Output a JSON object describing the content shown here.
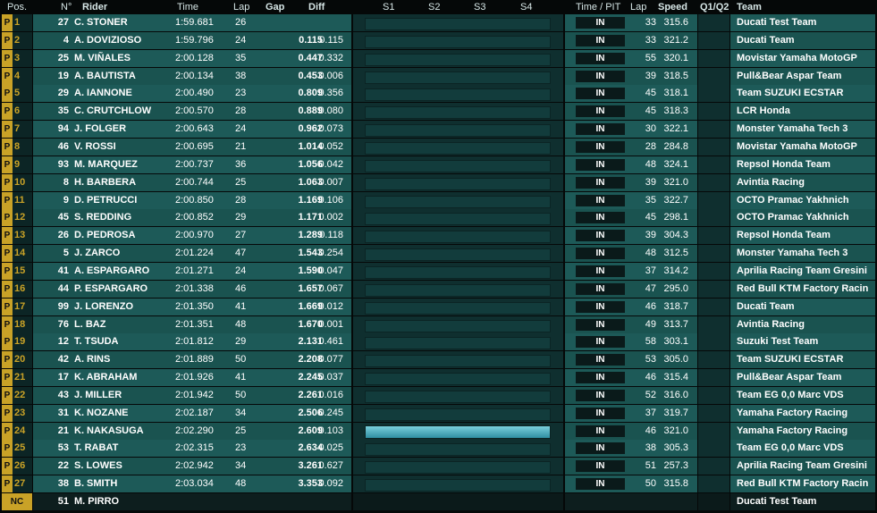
{
  "header": {
    "pos": "Pos.",
    "num": "N°",
    "rider": "Rider",
    "time": "Time",
    "lap": "Lap",
    "gap": "Gap",
    "diff": "Diff",
    "s1": "S1",
    "s2": "S2",
    "s3": "S3",
    "s4": "S4",
    "time_pit": "Time / PIT",
    "lap2": "Lap",
    "speed": "Speed",
    "q": "Q1/Q2",
    "team": "Team"
  },
  "rows": [
    {
      "flag": "P",
      "pos": "1",
      "num": "27",
      "rider": "C. STONER",
      "time": "1:59.681",
      "lap": "26",
      "gap": "",
      "diff": "",
      "pit": "IN",
      "plap": "33",
      "speed": "315.6",
      "team": "Ducati Test Team",
      "sector_active": false
    },
    {
      "flag": "P",
      "pos": "2",
      "num": "4",
      "rider": "A. DOVIZIOSO",
      "time": "1:59.796",
      "lap": "24",
      "gap": "0.115",
      "diff": "0.115",
      "pit": "IN",
      "plap": "33",
      "speed": "321.2",
      "team": "Ducati Team",
      "sector_active": false
    },
    {
      "flag": "P",
      "pos": "3",
      "num": "25",
      "rider": "M. VIÑALES",
      "time": "2:00.128",
      "lap": "35",
      "gap": "0.447",
      "diff": "0.332",
      "pit": "IN",
      "plap": "55",
      "speed": "320.1",
      "team": "Movistar Yamaha MotoGP",
      "sector_active": false
    },
    {
      "flag": "P",
      "pos": "4",
      "num": "19",
      "rider": "A. BAUTISTA",
      "time": "2:00.134",
      "lap": "38",
      "gap": "0.453",
      "diff": "0.006",
      "pit": "IN",
      "plap": "39",
      "speed": "318.5",
      "team": "Pull&Bear Aspar Team",
      "sector_active": false
    },
    {
      "flag": "P",
      "pos": "5",
      "num": "29",
      "rider": "A. IANNONE",
      "time": "2:00.490",
      "lap": "23",
      "gap": "0.809",
      "diff": "0.356",
      "pit": "IN",
      "plap": "45",
      "speed": "318.1",
      "team": "Team SUZUKI ECSTAR",
      "sector_active": false
    },
    {
      "flag": "P",
      "pos": "6",
      "num": "35",
      "rider": "C. CRUTCHLOW",
      "time": "2:00.570",
      "lap": "28",
      "gap": "0.889",
      "diff": "0.080",
      "pit": "IN",
      "plap": "45",
      "speed": "318.3",
      "team": "LCR Honda",
      "sector_active": false
    },
    {
      "flag": "P",
      "pos": "7",
      "num": "94",
      "rider": "J. FOLGER",
      "time": "2:00.643",
      "lap": "24",
      "gap": "0.962",
      "diff": "0.073",
      "pit": "IN",
      "plap": "30",
      "speed": "322.1",
      "team": "Monster Yamaha Tech 3",
      "sector_active": false
    },
    {
      "flag": "P",
      "pos": "8",
      "num": "46",
      "rider": "V. ROSSI",
      "time": "2:00.695",
      "lap": "21",
      "gap": "1.014",
      "diff": "0.052",
      "pit": "IN",
      "plap": "28",
      "speed": "284.8",
      "team": "Movistar Yamaha MotoGP",
      "sector_active": false
    },
    {
      "flag": "P",
      "pos": "9",
      "num": "93",
      "rider": "M. MARQUEZ",
      "time": "2:00.737",
      "lap": "36",
      "gap": "1.056",
      "diff": "0.042",
      "pit": "IN",
      "plap": "48",
      "speed": "324.1",
      "team": "Repsol Honda Team",
      "sector_active": false
    },
    {
      "flag": "P",
      "pos": "10",
      "num": "8",
      "rider": "H. BARBERA",
      "time": "2:00.744",
      "lap": "25",
      "gap": "1.063",
      "diff": "0.007",
      "pit": "IN",
      "plap": "39",
      "speed": "321.0",
      "team": "Avintia Racing",
      "sector_active": false
    },
    {
      "flag": "P",
      "pos": "11",
      "num": "9",
      "rider": "D. PETRUCCI",
      "time": "2:00.850",
      "lap": "28",
      "gap": "1.169",
      "diff": "0.106",
      "pit": "IN",
      "plap": "35",
      "speed": "322.7",
      "team": "OCTO Pramac Yakhnich",
      "sector_active": false
    },
    {
      "flag": "P",
      "pos": "12",
      "num": "45",
      "rider": "S. REDDING",
      "time": "2:00.852",
      "lap": "29",
      "gap": "1.171",
      "diff": "0.002",
      "pit": "IN",
      "plap": "45",
      "speed": "298.1",
      "team": "OCTO Pramac Yakhnich",
      "sector_active": false
    },
    {
      "flag": "P",
      "pos": "13",
      "num": "26",
      "rider": "D. PEDROSA",
      "time": "2:00.970",
      "lap": "27",
      "gap": "1.289",
      "diff": "0.118",
      "pit": "IN",
      "plap": "39",
      "speed": "304.3",
      "team": "Repsol Honda Team",
      "sector_active": false
    },
    {
      "flag": "P",
      "pos": "14",
      "num": "5",
      "rider": "J. ZARCO",
      "time": "2:01.224",
      "lap": "47",
      "gap": "1.543",
      "diff": "0.254",
      "pit": "IN",
      "plap": "48",
      "speed": "312.5",
      "team": "Monster Yamaha Tech 3",
      "sector_active": false
    },
    {
      "flag": "P",
      "pos": "15",
      "num": "41",
      "rider": "A. ESPARGARO",
      "time": "2:01.271",
      "lap": "24",
      "gap": "1.590",
      "diff": "0.047",
      "pit": "IN",
      "plap": "37",
      "speed": "314.2",
      "team": "Aprilia Racing Team Gresini",
      "sector_active": false
    },
    {
      "flag": "P",
      "pos": "16",
      "num": "44",
      "rider": "P. ESPARGARO",
      "time": "2:01.338",
      "lap": "46",
      "gap": "1.657",
      "diff": "0.067",
      "pit": "IN",
      "plap": "47",
      "speed": "295.0",
      "team": "Red Bull KTM Factory Racin",
      "sector_active": false
    },
    {
      "flag": "P",
      "pos": "17",
      "num": "99",
      "rider": "J. LORENZO",
      "time": "2:01.350",
      "lap": "41",
      "gap": "1.669",
      "diff": "0.012",
      "pit": "IN",
      "plap": "46",
      "speed": "318.7",
      "team": "Ducati Team",
      "sector_active": false
    },
    {
      "flag": "P",
      "pos": "18",
      "num": "76",
      "rider": "L. BAZ",
      "time": "2:01.351",
      "lap": "48",
      "gap": "1.670",
      "diff": "0.001",
      "pit": "IN",
      "plap": "49",
      "speed": "313.7",
      "team": "Avintia Racing",
      "sector_active": false
    },
    {
      "flag": "P",
      "pos": "19",
      "num": "12",
      "rider": "T. TSUDA",
      "time": "2:01.812",
      "lap": "29",
      "gap": "2.131",
      "diff": "0.461",
      "pit": "IN",
      "plap": "58",
      "speed": "303.1",
      "team": "Suzuki Test Team",
      "sector_active": false
    },
    {
      "flag": "P",
      "pos": "20",
      "num": "42",
      "rider": "A. RINS",
      "time": "2:01.889",
      "lap": "50",
      "gap": "2.208",
      "diff": "0.077",
      "pit": "IN",
      "plap": "53",
      "speed": "305.0",
      "team": "Team SUZUKI ECSTAR",
      "sector_active": false
    },
    {
      "flag": "P",
      "pos": "21",
      "num": "17",
      "rider": "K. ABRAHAM",
      "time": "2:01.926",
      "lap": "41",
      "gap": "2.245",
      "diff": "0.037",
      "pit": "IN",
      "plap": "46",
      "speed": "315.4",
      "team": "Pull&Bear Aspar Team",
      "sector_active": false
    },
    {
      "flag": "P",
      "pos": "22",
      "num": "43",
      "rider": "J. MILLER",
      "time": "2:01.942",
      "lap": "50",
      "gap": "2.261",
      "diff": "0.016",
      "pit": "IN",
      "plap": "52",
      "speed": "316.0",
      "team": "Team EG 0,0 Marc VDS",
      "sector_active": false
    },
    {
      "flag": "P",
      "pos": "23",
      "num": "31",
      "rider": "K. NOZANE",
      "time": "2:02.187",
      "lap": "34",
      "gap": "2.506",
      "diff": "0.245",
      "pit": "IN",
      "plap": "37",
      "speed": "319.7",
      "team": "Yamaha Factory Racing",
      "sector_active": false
    },
    {
      "flag": "P",
      "pos": "24",
      "num": "21",
      "rider": "K. NAKASUGA",
      "time": "2:02.290",
      "lap": "25",
      "gap": "2.609",
      "diff": "0.103",
      "pit": "IN",
      "plap": "46",
      "speed": "321.0",
      "team": "Yamaha Factory Racing",
      "sector_active": true
    },
    {
      "flag": "P",
      "pos": "25",
      "num": "53",
      "rider": "T. RABAT",
      "time": "2:02.315",
      "lap": "23",
      "gap": "2.634",
      "diff": "0.025",
      "pit": "IN",
      "plap": "38",
      "speed": "305.3",
      "team": "Team EG 0,0 Marc VDS",
      "sector_active": false
    },
    {
      "flag": "P",
      "pos": "26",
      "num": "22",
      "rider": "S. LOWES",
      "time": "2:02.942",
      "lap": "34",
      "gap": "3.261",
      "diff": "0.627",
      "pit": "IN",
      "plap": "51",
      "speed": "257.3",
      "team": "Aprilia Racing Team Gresini",
      "sector_active": false
    },
    {
      "flag": "P",
      "pos": "27",
      "num": "38",
      "rider": "B. SMITH",
      "time": "2:03.034",
      "lap": "48",
      "gap": "3.353",
      "diff": "0.092",
      "pit": "IN",
      "plap": "50",
      "speed": "315.8",
      "team": "Red Bull KTM Factory Racin",
      "sector_active": false
    }
  ],
  "nc_row": {
    "pos": "NC",
    "num": "51",
    "rider": "M. PIRRO",
    "team": "Ducati Test Team"
  }
}
